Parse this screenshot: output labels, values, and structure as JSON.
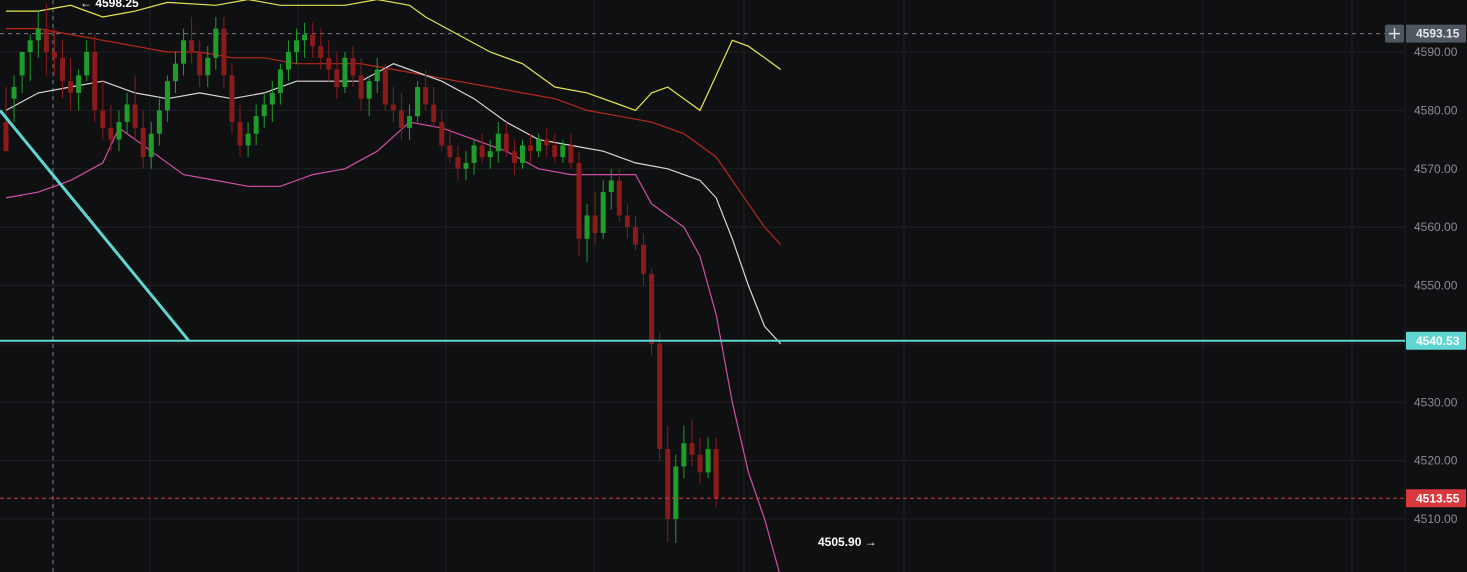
{
  "chart_data": {
    "type": "candlestick",
    "y_axis": {
      "ticks": [
        "4590.00",
        "4580.00",
        "4570.00",
        "4560.00",
        "4550.00",
        "4530.00",
        "4520.00",
        "4510.00"
      ],
      "tick_values": [
        4590,
        4580,
        4570,
        4560,
        4550,
        4530,
        4520,
        4510
      ],
      "range": [
        4501.6,
        4599.4
      ],
      "position": "right"
    },
    "price_tags": {
      "crosshair": {
        "label": "4593.15",
        "value": 4593.15
      },
      "horizontal_line": {
        "label": "4540.53",
        "value": 4540.53
      },
      "last_price": {
        "label": "4513.55",
        "value": 4513.55
      }
    },
    "annotations": {
      "high": {
        "label": "← 4598.25",
        "value": 4598.25
      },
      "low": {
        "label": "4505.90 →",
        "value": 4505.9
      }
    },
    "colors": {
      "background": "#0f1012",
      "grid": "#1e2024",
      "up": "#1f9d2c",
      "down": "#8b1a1a",
      "upper_band": "#e6e64a",
      "lower_band": "#d34ea8",
      "middle_band": "#d8d8d8",
      "ma_long": "#b82a1c",
      "drawn_line": "#5fd6d2",
      "last_price_tag": "#d9383c",
      "crosshair_tag": "#4f5761"
    },
    "candles": [
      [
        4578,
        4584,
        4575,
        4573
      ],
      [
        4582,
        4586,
        4578,
        4584
      ],
      [
        4586,
        4590,
        4583,
        4590
      ],
      [
        4590,
        4593,
        4585,
        4592
      ],
      [
        4592,
        4597,
        4589,
        4594
      ],
      [
        4594,
        4598.25,
        4586,
        4590
      ],
      [
        4590,
        4594,
        4586,
        4589
      ],
      [
        4589,
        4592,
        4582,
        4585
      ],
      [
        4585,
        4589,
        4580,
        4583
      ],
      [
        4583,
        4587,
        4580,
        4586
      ],
      [
        4586,
        4592,
        4585,
        4590
      ],
      [
        4590,
        4593,
        4578,
        4580
      ],
      [
        4580,
        4585,
        4575,
        4577
      ],
      [
        4577,
        4581,
        4573,
        4575
      ],
      [
        4575,
        4580,
        4573,
        4578
      ],
      [
        4578,
        4583,
        4576,
        4581
      ],
      [
        4581,
        4586,
        4575,
        4577
      ],
      [
        4577,
        4580,
        4570,
        4572
      ],
      [
        4572,
        4578,
        4570,
        4576
      ],
      [
        4576,
        4582,
        4574,
        4580
      ],
      [
        4580,
        4586,
        4578,
        4585
      ],
      [
        4585,
        4590,
        4583,
        4588
      ],
      [
        4588,
        4594,
        4586,
        4592
      ],
      [
        4592,
        4596,
        4588,
        4590
      ],
      [
        4590,
        4592,
        4584,
        4586
      ],
      [
        4586,
        4591,
        4584,
        4589
      ],
      [
        4589,
        4596,
        4587,
        4594
      ],
      [
        4594,
        4596,
        4584,
        4586
      ],
      [
        4586,
        4588,
        4576,
        4578
      ],
      [
        4578,
        4581,
        4572,
        4574
      ],
      [
        4574,
        4578,
        4572,
        4576
      ],
      [
        4576,
        4581,
        4574,
        4579
      ],
      [
        4579,
        4583,
        4577,
        4581
      ],
      [
        4581,
        4585,
        4578,
        4583
      ],
      [
        4583,
        4588,
        4581,
        4587
      ],
      [
        4587,
        4592,
        4585,
        4590
      ],
      [
        4590,
        4594,
        4588,
        4592
      ],
      [
        4592,
        4595,
        4589,
        4593
      ],
      [
        4593,
        4595,
        4589,
        4591
      ],
      [
        4591,
        4594,
        4587,
        4589
      ],
      [
        4589,
        4592,
        4585,
        4587
      ],
      [
        4587,
        4590,
        4582,
        4584
      ],
      [
        4584,
        4590,
        4583,
        4589
      ],
      [
        4589,
        4591,
        4584,
        4586
      ],
      [
        4586,
        4589,
        4580,
        4582
      ],
      [
        4582,
        4586,
        4579,
        4585
      ],
      [
        4585,
        4589,
        4583,
        4587
      ],
      [
        4587,
        4588,
        4580,
        4581
      ],
      [
        4581,
        4584,
        4578,
        4580
      ],
      [
        4580,
        4583,
        4575,
        4577
      ],
      [
        4577,
        4581,
        4575,
        4579
      ],
      [
        4579,
        4585,
        4578,
        4584
      ],
      [
        4584,
        4587,
        4580,
        4581
      ],
      [
        4581,
        4584,
        4577,
        4578
      ],
      [
        4578,
        4580,
        4573,
        4574
      ],
      [
        4574,
        4577,
        4571,
        4572
      ],
      [
        4572,
        4574,
        4568,
        4570
      ],
      [
        4570,
        4573,
        4568,
        4571
      ],
      [
        4571,
        4575,
        4569,
        4574
      ],
      [
        4574,
        4576,
        4571,
        4572
      ],
      [
        4572,
        4575,
        4570,
        4573
      ],
      [
        4573,
        4578,
        4571,
        4576
      ],
      [
        4576,
        4578,
        4572,
        4573
      ],
      [
        4573,
        4575,
        4569,
        4571
      ],
      [
        4571,
        4575,
        4570,
        4574
      ],
      [
        4574,
        4576,
        4571,
        4573
      ],
      [
        4573,
        4576,
        4572,
        4575
      ],
      [
        4575,
        4577,
        4572,
        4574
      ],
      [
        4574,
        4576,
        4571,
        4572
      ],
      [
        4572,
        4575,
        4571,
        4574
      ],
      [
        4574,
        4576,
        4570,
        4571
      ],
      [
        4571,
        4573,
        4555,
        4558
      ],
      [
        4558,
        4564,
        4554,
        4562
      ],
      [
        4562,
        4566,
        4557,
        4559
      ],
      [
        4559,
        4568,
        4558,
        4566
      ],
      [
        4566,
        4570,
        4563,
        4568
      ],
      [
        4568,
        4570,
        4561,
        4562
      ],
      [
        4562,
        4564,
        4558,
        4560
      ],
      [
        4560,
        4562,
        4556,
        4557
      ],
      [
        4557,
        4559,
        4550,
        4552
      ],
      [
        4552,
        4553,
        4538,
        4540
      ],
      [
        4540,
        4542,
        4520,
        4522
      ],
      [
        4522,
        4526,
        4506,
        4510
      ],
      [
        4510,
        4521,
        4505.9,
        4519
      ],
      [
        4519,
        4526,
        4517,
        4523
      ],
      [
        4523,
        4527,
        4519,
        4521
      ],
      [
        4521,
        4524,
        4516,
        4518
      ],
      [
        4518,
        4524,
        4517,
        4522
      ],
      [
        4522,
        4524,
        4512,
        4513.55
      ]
    ],
    "upper_band": [
      [
        0,
        4597
      ],
      [
        4,
        4597
      ],
      [
        8,
        4598
      ],
      [
        12,
        4596
      ],
      [
        16,
        4597
      ],
      [
        20,
        4598.5
      ],
      [
        26,
        4598
      ],
      [
        30,
        4599
      ],
      [
        34,
        4598
      ],
      [
        38,
        4598
      ],
      [
        42,
        4598
      ],
      [
        46,
        4599
      ],
      [
        50,
        4598
      ],
      [
        52,
        4596
      ],
      [
        56,
        4593
      ],
      [
        60,
        4590
      ],
      [
        64,
        4588
      ],
      [
        68,
        4584
      ],
      [
        72,
        4583
      ],
      [
        76,
        4581
      ],
      [
        78,
        4580
      ],
      [
        80,
        4583
      ],
      [
        82,
        4584
      ],
      [
        86,
        4580
      ],
      [
        88,
        4586
      ],
      [
        90,
        4592
      ],
      [
        92,
        4591
      ],
      [
        94,
        4589
      ],
      [
        96,
        4587
      ]
    ],
    "lower_band": [
      [
        0,
        4565
      ],
      [
        4,
        4566
      ],
      [
        8,
        4568
      ],
      [
        12,
        4571
      ],
      [
        14,
        4577
      ],
      [
        18,
        4573
      ],
      [
        22,
        4569
      ],
      [
        26,
        4568
      ],
      [
        30,
        4567
      ],
      [
        34,
        4567
      ],
      [
        38,
        4569
      ],
      [
        42,
        4570
      ],
      [
        46,
        4573
      ],
      [
        50,
        4578
      ],
      [
        54,
        4577
      ],
      [
        58,
        4575
      ],
      [
        62,
        4573
      ],
      [
        66,
        4570
      ],
      [
        70,
        4569
      ],
      [
        74,
        4569
      ],
      [
        78,
        4569
      ],
      [
        80,
        4564
      ],
      [
        84,
        4560
      ],
      [
        86,
        4555
      ],
      [
        88,
        4545
      ],
      [
        90,
        4530
      ],
      [
        92,
        4518
      ],
      [
        94,
        4510
      ],
      [
        96,
        4500
      ]
    ],
    "middle_band": [
      [
        0,
        4580
      ],
      [
        4,
        4583
      ],
      [
        8,
        4584
      ],
      [
        12,
        4585
      ],
      [
        16,
        4583
      ],
      [
        20,
        4582
      ],
      [
        24,
        4583
      ],
      [
        28,
        4582
      ],
      [
        32,
        4583
      ],
      [
        36,
        4585
      ],
      [
        40,
        4585
      ],
      [
        44,
        4585
      ],
      [
        48,
        4588
      ],
      [
        50,
        4587
      ],
      [
        54,
        4585
      ],
      [
        58,
        4582
      ],
      [
        62,
        4578
      ],
      [
        66,
        4575
      ],
      [
        70,
        4574
      ],
      [
        74,
        4573
      ],
      [
        78,
        4571
      ],
      [
        82,
        4570
      ],
      [
        86,
        4568
      ],
      [
        88,
        4565
      ],
      [
        90,
        4558
      ],
      [
        92,
        4550
      ],
      [
        94,
        4543
      ],
      [
        96,
        4540
      ]
    ],
    "ma_long": [
      [
        0,
        4594
      ],
      [
        4,
        4594
      ],
      [
        8,
        4593
      ],
      [
        12,
        4592
      ],
      [
        16,
        4591
      ],
      [
        20,
        4590
      ],
      [
        24,
        4590
      ],
      [
        28,
        4589
      ],
      [
        32,
        4589
      ],
      [
        36,
        4588
      ],
      [
        40,
        4588
      ],
      [
        44,
        4588
      ],
      [
        48,
        4587
      ],
      [
        52,
        4586
      ],
      [
        56,
        4585
      ],
      [
        60,
        4584
      ],
      [
        64,
        4583
      ],
      [
        68,
        4582
      ],
      [
        72,
        4580
      ],
      [
        76,
        4579
      ],
      [
        80,
        4578
      ],
      [
        84,
        4576
      ],
      [
        88,
        4572
      ],
      [
        90,
        4568
      ],
      [
        92,
        4564
      ],
      [
        94,
        4560
      ],
      [
        96,
        4557
      ]
    ],
    "drawn_line": {
      "start_value": 4580,
      "end_value": 4540.5,
      "horizontal_value": 4540.53
    }
  }
}
